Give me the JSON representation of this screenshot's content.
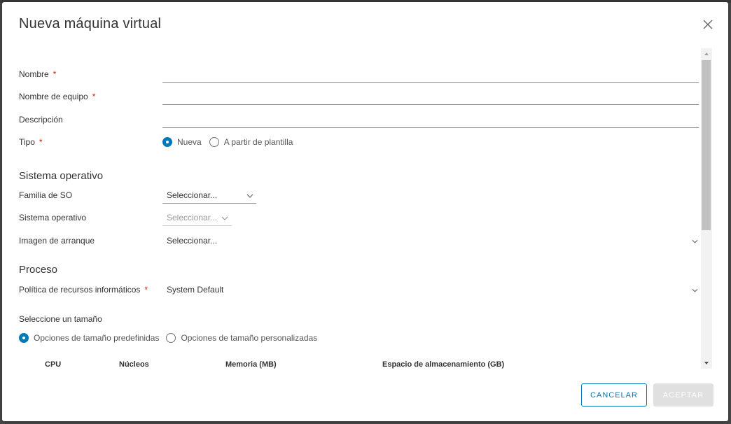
{
  "modal": {
    "title": "Nueva máquina virtual"
  },
  "form": {
    "name_label": "Nombre",
    "hostname_label": "Nombre de equipo",
    "description_label": "Descripción",
    "type_label": "Tipo",
    "type_options": [
      "Nueva",
      "A partir de plantilla"
    ],
    "type_selected": "Nueva",
    "required_mark": "*"
  },
  "os_section": {
    "title": "Sistema operativo",
    "family_label": "Familia de SO",
    "family_value": "Seleccionar...",
    "os_label": "Sistema operativo",
    "os_value": "Seleccionar...",
    "boot_label": "Imagen de arranque",
    "boot_value": "Seleccionar..."
  },
  "compute_section": {
    "title": "Proceso",
    "policy_label": "Política de recursos informáticos",
    "policy_value": "System Default",
    "size_label": "Seleccione un tamaño",
    "size_options": [
      "Opciones de tamaño predefinidas",
      "Opciones de tamaño personalizadas"
    ],
    "size_selected": "Opciones de tamaño predefinidas",
    "table_headers": [
      "CPU",
      "Núcleos",
      "Memoria (MB)",
      "Espacio de almacenamiento (GB)"
    ]
  },
  "footer": {
    "cancel_label": "CANCELAR",
    "accept_label": "ACEPTAR"
  },
  "colors": {
    "accent": "#0079b8",
    "required": "#c92100",
    "disabled_button": "#e0e0e0"
  }
}
